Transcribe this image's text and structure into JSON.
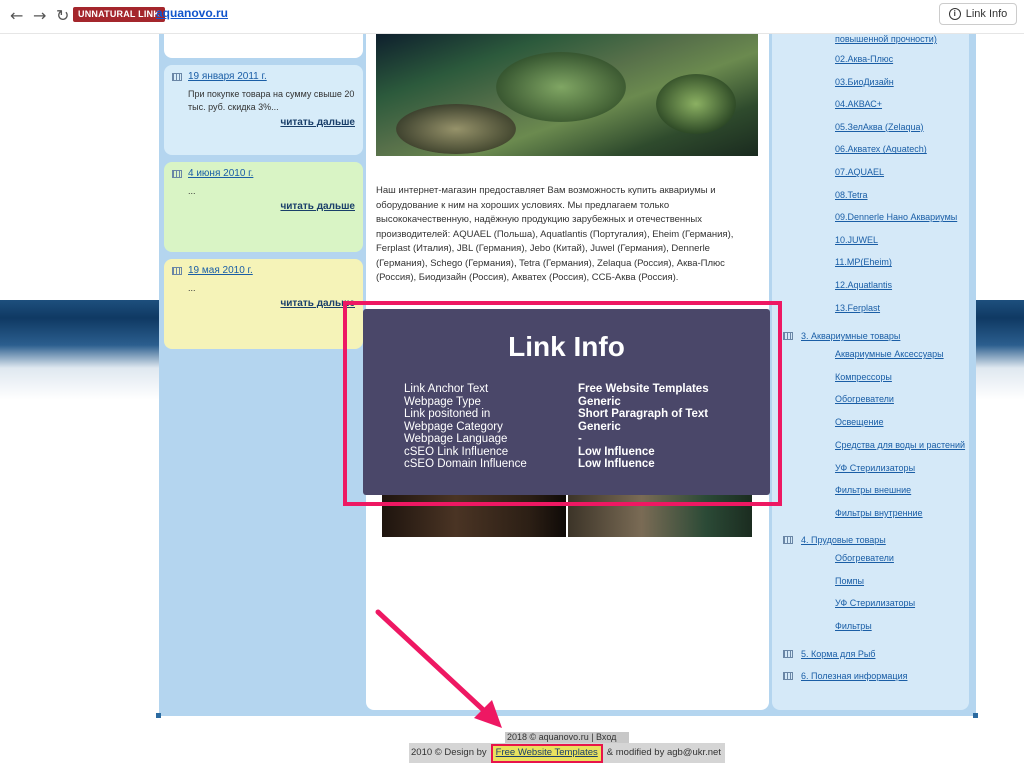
{
  "browser": {
    "badge": "UNNATURAL LINK",
    "domain": "aquanovo.ru",
    "link_info_button": "Link Info",
    "back_icon": "arrow-left-icon",
    "forward_icon": "arrow-right-icon",
    "reload_icon": "reload-icon"
  },
  "news": [
    {
      "date": "19 января 2011 г.",
      "text": "При покупке товара на сумму свыше 20 тыс. руб. скидка 3%...",
      "more": "читать дальше",
      "bg": "#d7ecf9"
    },
    {
      "date": "4 июня 2010 г.",
      "text": "...",
      "more": "читать дальше",
      "bg": "#d9f4c5"
    },
    {
      "date": "19 мая 2010 г.",
      "text": "...",
      "more": "читать дальше",
      "bg": "#f5f3b8"
    }
  ],
  "intro": "Наш интернет-магазин предоставляет Вам возможность купить аквариумы и оборудование к ним на хороших условиях. Мы предлагаем только высококачественную, надёжную продукцию зарубежных и отечественных производителей: AQUAEL (Польша), Aquatlantis (Португалия), Eheim (Германия), Ferplast (Италия), JBL (Германия), Jebo (Китай), Juwel (Германия), Dennerle (Германия), Schego (Германия), Tetra (Германия), Zelaqua (Россия), Аква-Плюс (Россия), Биодизайн (Россия), Акватех (Россия), ССБ-Аква (Россия).",
  "right": {
    "top_item": "повышенной прочности)",
    "brands": [
      "02.Аква-Плюс",
      "03.БиоДизайн",
      "04.АКВАС+",
      "05.ЗелАква (Zelaqua)",
      "06.Акватех (Aquatech)",
      "07.AQUAEL",
      "08.Tetra",
      "09.Dennerle Нано Аквариумы",
      "10.JUWEL",
      "11.MP(Eheim)",
      "12.Aquatlantis",
      "13.Ferplast"
    ],
    "cat3": "3. Аквариумные товары",
    "cat3_items": [
      "Аквариумные Аксессуары",
      "Компрессоры",
      "Обогреватели",
      "Освещение",
      "Средства для воды и растений",
      "УФ Стерилизаторы",
      "Фильтры внешние",
      "Фильтры внутренние"
    ],
    "cat4": "4. Прудовые товары",
    "cat4_items": [
      "Обогреватели",
      "Помпы",
      "УФ Стерилизаторы",
      "Фильтры"
    ],
    "cat5": "5. Корма для Рыб",
    "cat6": "6. Полезная информация"
  },
  "footer": {
    "line1": "2018 © aquanovo.ru | Вход",
    "prefix": "2010 © Design by",
    "link": "Free Website Templates",
    "suffix": "& modified by agb@ukr.net"
  },
  "link_info": {
    "title": "Link Info",
    "rows": [
      {
        "k": "Link Anchor Text",
        "v": "Free Website Templates"
      },
      {
        "k": "Webpage Type",
        "v": "Generic"
      },
      {
        "k": "Link positoned in",
        "v": "Short Paragraph of Text"
      },
      {
        "k": "Webpage Category",
        "v": "Generic"
      },
      {
        "k": "Webpage Language",
        "v": "-"
      },
      {
        "k": "cSEO Link Influence",
        "v": "Low Influence"
      },
      {
        "k": "cSEO Domain Influence",
        "v": "Low Influence"
      }
    ],
    "panel_color": "#4a4769",
    "highlight_color": "#ee1863"
  }
}
